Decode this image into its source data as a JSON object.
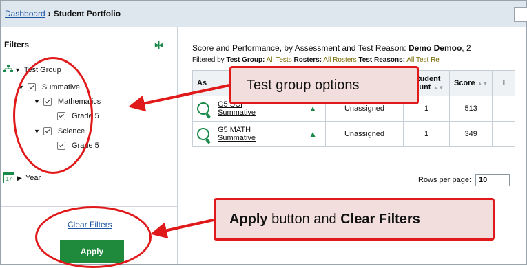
{
  "breadcrumb": {
    "link": "Dashboard",
    "separator": "›",
    "current": "Student Portfolio"
  },
  "sidebar": {
    "title": "Filters",
    "collapse_icon": "collapse-panel-icon",
    "test_group": {
      "label": "Test Group",
      "icon": "hierarchy-icon"
    },
    "summative": "Summative",
    "mathematics": "Mathematics",
    "math_grade": "Grade 5",
    "science": "Science",
    "science_grade": "Grade 5",
    "year": {
      "label": "Year",
      "icon": "calendar-icon",
      "icon_text": "17"
    },
    "clear_filters": "Clear Filters",
    "apply": "Apply"
  },
  "main": {
    "summary_prefix": "Score and Performance, by Assessment and Test Reason: ",
    "summary_name": "Demo Demoo",
    "summary_suffix": ", 2",
    "filtered_by": "Filtered by",
    "f1_label": "Test Group:",
    "f1_value": " All Tests ",
    "f2_label": "Rosters:",
    "f2_value": " All Rosters ",
    "f3_label": "Test Reasons:",
    "f3_value": " All Test Re",
    "table": {
      "col_assessment": "As",
      "col_student_count": "Student Count",
      "col_score": "Score",
      "col_extra": "I",
      "rows": [
        {
          "assessment_line1": "G5 SCI",
          "assessment_line2": "Summative",
          "reason": "Unassigned",
          "count": "1",
          "score": "513"
        },
        {
          "assessment_line1": "G5 MATH",
          "assessment_line2": "Summative",
          "reason": "Unassigned",
          "count": "1",
          "score": "349"
        }
      ]
    },
    "rows_per_page_label": "Rows per page:",
    "rows_per_page_value": "10"
  },
  "annotations": {
    "test_group_callout": "Test group options",
    "apply_callout_bold1": "Apply",
    "apply_callout_mid": " button and ",
    "apply_callout_bold2": "Clear Filters"
  },
  "colors": {
    "accent_red": "#e01a1a",
    "apply_green": "#1f8a3c",
    "link_blue": "#1c55a4"
  }
}
